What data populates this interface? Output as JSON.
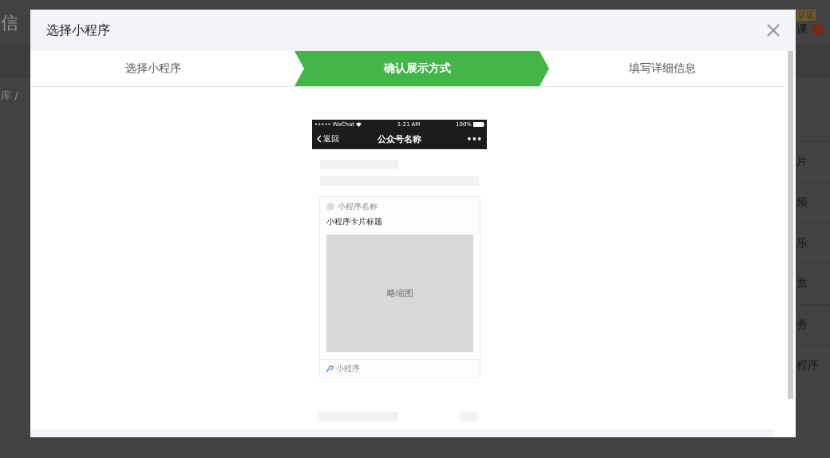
{
  "background": {
    "title_fragment": "信",
    "badge": "认证",
    "nav_fragment": "课",
    "breadcrumb": "库 /",
    "side_items": [
      "片",
      "频",
      "乐",
      "票",
      "券",
      "程序"
    ]
  },
  "dialog": {
    "title": "选择小程序",
    "steps": [
      {
        "label": "选择小程序",
        "selected": false
      },
      {
        "label": "确认展示方式",
        "selected": true
      },
      {
        "label": "填写详细信息",
        "selected": false
      }
    ],
    "preview": {
      "status_bar": {
        "carrier": "••••• WeChat",
        "time": "1:21 AM",
        "battery": "100%"
      },
      "nav": {
        "back": "返回",
        "title": "公众号名称",
        "more": "•••"
      },
      "card": {
        "app_name": "小程序名称",
        "title": "小程序卡片标题",
        "thumbnail": "略缩图",
        "footer": "小程序"
      }
    }
  }
}
